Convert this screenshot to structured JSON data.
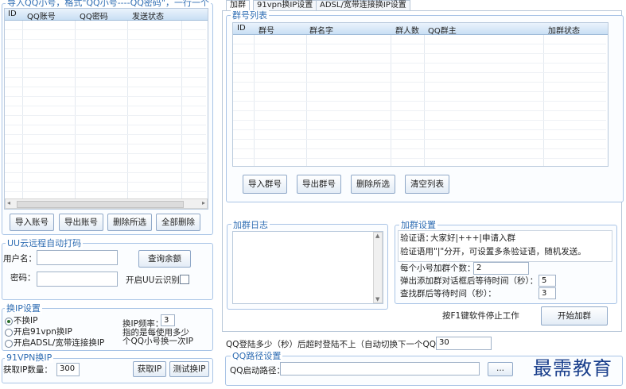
{
  "import_section": {
    "hint": "导入QQ小号，格式\"QQ小号----QQ密码\"，一行一个",
    "columns": [
      "ID",
      "QQ账号",
      "QQ密码",
      "发送状态"
    ],
    "buttons": [
      "导入账号",
      "导出账号",
      "删除所选",
      "全部删除"
    ]
  },
  "uu_section": {
    "legend": "UU云远程自动打码",
    "username_label": "用户名：",
    "password_label": "密码：",
    "balance_button": "查询余额",
    "enable_label": "开启UU云识别"
  },
  "ip_section": {
    "legend": "换IP设置",
    "options": [
      "不换IP",
      "开启91vpn换IP",
      "开启ADSL/宽带连接换IP"
    ],
    "freq_label": "换IP频率：",
    "freq_value": "3",
    "freq_note": [
      "指的是每使用多少",
      "个QQ小号换一次IP"
    ]
  },
  "vpn_section": {
    "legend": "91VPN换IP",
    "count_label": "获取IP数量：",
    "count_value": "300",
    "get_button": "获取IP",
    "test_button": "测试换IP"
  },
  "tabs": [
    "加群",
    "91vpn换IP设置",
    "ADSL/宽带连接换IP设置"
  ],
  "group_list": {
    "legend": "群号列表",
    "columns": [
      "ID",
      "群号",
      "群名字",
      "群人数",
      "QQ群主",
      "加群状态"
    ],
    "buttons": [
      "导入群号",
      "导出群号",
      "删除所选",
      "清空列表"
    ]
  },
  "log": {
    "legend": "加群日志"
  },
  "join_settings": {
    "legend": "加群设置",
    "verify_label": "验证语：",
    "verify_value": "大家好|+++|申请入群",
    "verify_note": "验证语用\"|\"分开，可设置多条验证语，随机发送。",
    "per_account_label": "每个小号加群个数：",
    "per_account_value": "2",
    "dialog_wait_label": "弹出添加群对话框后等待时间（秒）：",
    "dialog_wait_value": "5",
    "search_wait_label": "查找群后等待时间（秒）：",
    "search_wait_value": "3",
    "stop_hint": "按F1键软件停止工作",
    "start_button": "开始加群"
  },
  "login_timeout": {
    "label": "QQ登陆多少（秒）后超时登陆不上（自动切换下一个QQ）：",
    "value": "30"
  },
  "qq_path": {
    "legend": "QQ路径设置",
    "label": "QQ启动路径：",
    "value": "",
    "browse_button": "..."
  },
  "watermark": "最需教育"
}
